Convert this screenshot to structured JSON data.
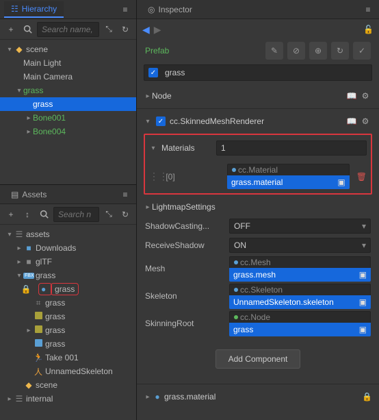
{
  "hierarchy": {
    "title": "Hierarchy",
    "search_placeholder": "Search name,",
    "nodes": {
      "scene": "scene",
      "main_light": "Main Light",
      "main_camera": "Main Camera",
      "grass1": "grass",
      "grass2": "grass",
      "bone001": "Bone001",
      "bone004": "Bone004"
    }
  },
  "assets": {
    "title": "Assets",
    "search_placeholder": "Search n",
    "items": {
      "root": "assets",
      "downloads": "Downloads",
      "gltf": "glTF",
      "grass_fbx": "grass",
      "grass_mat": "grass",
      "grass_mesh": "grass",
      "grass_prefab": "grass",
      "grass_tex": "grass",
      "grass_skin": "grass",
      "take001": "Take 001",
      "unnamed_skel": "UnnamedSkeleton",
      "scene": "scene",
      "internal": "internal"
    },
    "fbx_badge": "FBX"
  },
  "inspector": {
    "title": "Inspector",
    "prefab_label": "Prefab",
    "node_name": "grass",
    "node_section": "Node",
    "component": {
      "name": "cc.SkinnedMeshRenderer",
      "materials_label": "Materials",
      "materials_count": "1",
      "material_slot_idx": "[0]",
      "material_type": "cc.Material",
      "material_value": "grass.material",
      "lightmap_label": "LightmapSettings",
      "shadow_casting_label": "ShadowCasting...",
      "shadow_casting_value": "OFF",
      "receive_shadow_label": "ReceiveShadow",
      "receive_shadow_value": "ON",
      "mesh_label": "Mesh",
      "mesh_type": "cc.Mesh",
      "mesh_value": "grass.mesh",
      "skeleton_label": "Skeleton",
      "skeleton_type": "cc.Skeleton",
      "skeleton_value": "UnnamedSkeleton.skeleton",
      "skinning_root_label": "SkinningRoot",
      "skinning_root_type": "cc.Node",
      "skinning_root_value": "grass"
    },
    "add_component": "Add Component",
    "grass_material_footer": "grass.material"
  }
}
